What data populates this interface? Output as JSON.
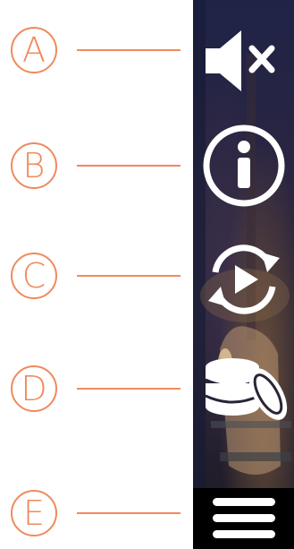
{
  "callouts": [
    {
      "letter": "A",
      "target": "sound-toggle"
    },
    {
      "letter": "B",
      "target": "info"
    },
    {
      "letter": "C",
      "target": "autoplay"
    },
    {
      "letter": "D",
      "target": "bet"
    },
    {
      "letter": "E",
      "target": "menu"
    }
  ],
  "colors": {
    "callout_accent": "#f08a5d",
    "icon_color": "#ffffff",
    "menu_background": "#000000"
  },
  "panel": {
    "icons": [
      "speaker-muted-icon",
      "info-icon",
      "autoplay-icon",
      "coin-stack-icon",
      "hamburger-menu-icon"
    ]
  }
}
